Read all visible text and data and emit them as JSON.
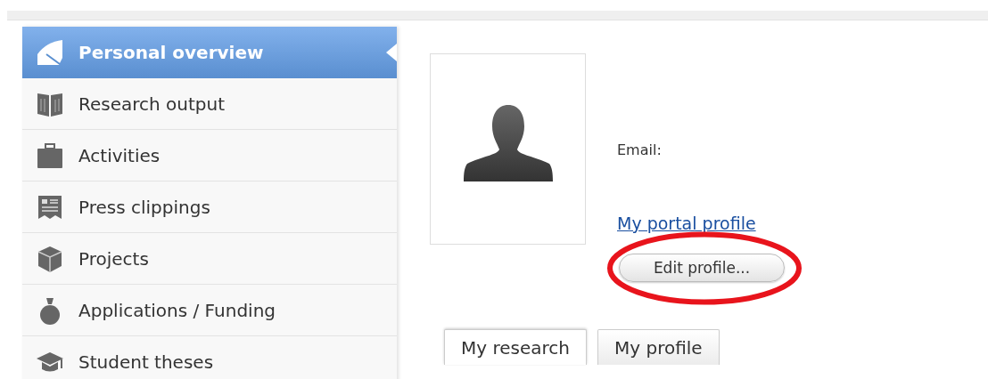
{
  "sidebar": {
    "items": [
      {
        "label": "Personal overview",
        "kind": "overview",
        "selected": true
      },
      {
        "label": "Research output",
        "kind": "book",
        "selected": false
      },
      {
        "label": "Activities",
        "kind": "briefcase",
        "selected": false
      },
      {
        "label": "Press clippings",
        "kind": "newspaper",
        "selected": false
      },
      {
        "label": "Projects",
        "kind": "cube",
        "selected": false
      },
      {
        "label": "Applications / Funding",
        "kind": "moneybag",
        "selected": false
      },
      {
        "label": "Student theses",
        "kind": "cap",
        "selected": false
      }
    ]
  },
  "profile": {
    "email_label": "Email:",
    "portal_link": "My portal profile",
    "edit_button": "Edit profile..."
  },
  "tabs": [
    {
      "label": "My research",
      "selected": true
    },
    {
      "label": "My profile",
      "selected": false
    }
  ]
}
